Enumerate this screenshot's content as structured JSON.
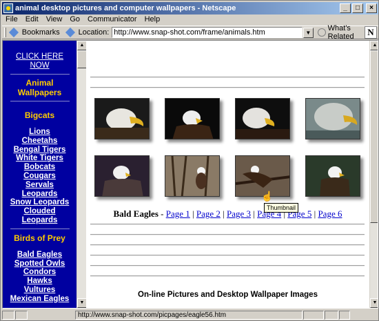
{
  "window": {
    "title": "animal desktop pictures and computer wallpapers - Netscape"
  },
  "menu": {
    "items": [
      "File",
      "Edit",
      "View",
      "Go",
      "Communicator",
      "Help"
    ]
  },
  "toolbar": {
    "bookmarks_label": "Bookmarks",
    "location_label": "Location:",
    "location_url": "http://www.snap-shot.com/frame/animals.htm",
    "related_label": "What's Related"
  },
  "sidebar": {
    "top_link": [
      "CLICK HERE",
      "NOW"
    ],
    "section_title": [
      "Animal",
      "Wallpapers"
    ],
    "groups": [
      {
        "heading": "Bigcats",
        "links": [
          "Lions",
          "Cheetahs",
          "Bengal Tigers",
          "White Tigers",
          "Bobcats",
          "Cougars",
          "Servals",
          "Leopards",
          "Snow Leopards",
          "Clouded",
          "Leopards"
        ]
      },
      {
        "heading": "Birds of Prey",
        "links": [
          "Bald Eagles",
          "Spotted Owls",
          "Condors",
          "Hawks",
          "Vultures",
          "Mexican Eagles"
        ]
      }
    ]
  },
  "gallery": {
    "category": "Bald Eagles",
    "separator": " - ",
    "pages": [
      "Page 1",
      "Page 2",
      "Page 3",
      "Page 4",
      "Page 5",
      "Page 6"
    ],
    "tooltip": "Thumbnail"
  },
  "footer": {
    "heading": "On-line Pictures and Desktop Wallpaper Images"
  },
  "status": {
    "url": "http://www.snap-shot.com/picpages/eagle56.htm"
  }
}
